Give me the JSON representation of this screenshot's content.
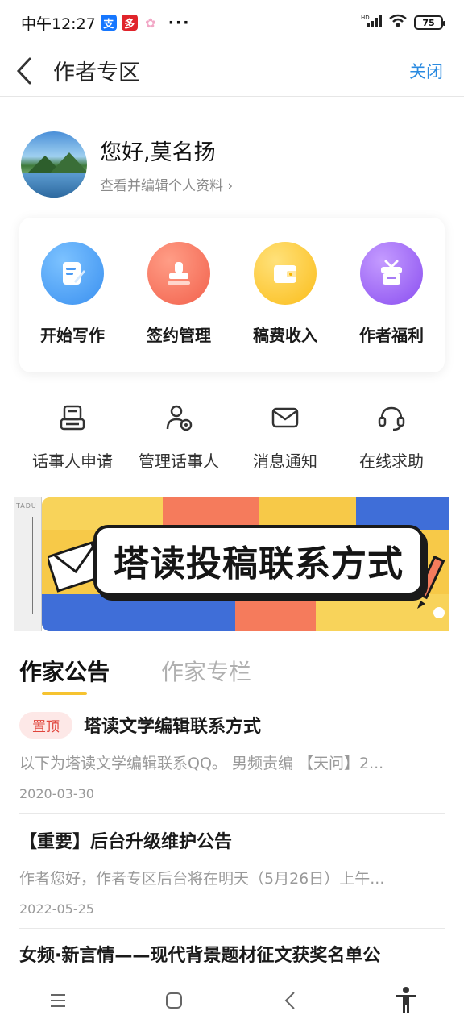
{
  "status_bar": {
    "time": "中午12:27",
    "alipay_glyph": "支",
    "app_glyph": "多",
    "pink_glyph": "✿",
    "dots": "···",
    "hd": "HD",
    "battery": "75"
  },
  "header": {
    "title": "作者专区",
    "close_label": "关闭"
  },
  "profile": {
    "greeting": "您好,莫名扬",
    "edit_link": "查看并编辑个人资料 ›"
  },
  "main_actions": [
    {
      "label": "开始写作",
      "icon": "write-icon",
      "color": "#3a90f0"
    },
    {
      "label": "签约管理",
      "icon": "stamp-icon",
      "color": "#f2614c"
    },
    {
      "label": "稿费收入",
      "icon": "wallet-icon",
      "color": "#fbbd1a"
    },
    {
      "label": "作者福利",
      "icon": "gift-icon",
      "color": "#8a4ef0"
    }
  ],
  "secondary_actions": [
    {
      "label": "话事人申请",
      "icon": "printer-icon"
    },
    {
      "label": "管理话事人",
      "icon": "user-settings-icon"
    },
    {
      "label": "消息通知",
      "icon": "mail-icon"
    },
    {
      "label": "在线求助",
      "icon": "headset-icon"
    }
  ],
  "banner": {
    "text": "塔读投稿联系方式",
    "side_text": "TADU"
  },
  "tabs": [
    {
      "label": "作家公告",
      "active": true
    },
    {
      "label": "作家专栏",
      "active": false
    }
  ],
  "notices": [
    {
      "badge": "置顶",
      "title": "塔读文学编辑联系方式",
      "summary": "以下为塔读文学编辑联系QQ。 男频责编 【天问】2...",
      "date": "2020-03-30"
    },
    {
      "badge": "",
      "title": "【重要】后台升级维护公告",
      "summary": "作者您好，作者专区后台将在明天（5月26日）上午...",
      "date": "2022-05-25"
    },
    {
      "badge": "",
      "title": "女频·新言情——现代背景题材征文获奖名单公",
      "summary": "",
      "date": ""
    }
  ],
  "colors": {
    "accent": "#2a8ae0",
    "tab_underline": "#f6c330",
    "pin_badge": "#e0443b"
  }
}
